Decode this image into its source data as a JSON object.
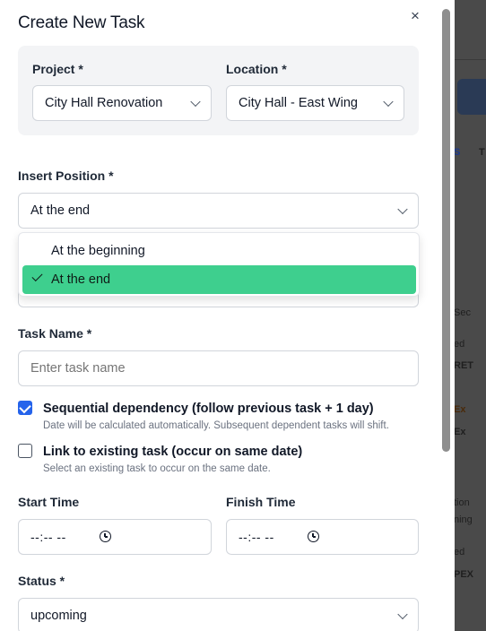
{
  "modal": {
    "title": "Create New Task",
    "close_icon": "×"
  },
  "project": {
    "label": "Project *",
    "value": "City Hall Renovation"
  },
  "location": {
    "label": "Location *",
    "value": "City Hall - East Wing"
  },
  "insert_position": {
    "label": "Insert Position *",
    "value": "At the end",
    "options": [
      {
        "label": "At the beginning",
        "selected": false
      },
      {
        "label": "At the end",
        "selected": true
      }
    ]
  },
  "task_name": {
    "label": "Task Name *",
    "placeholder": "Enter task name",
    "value": ""
  },
  "sequential": {
    "checked": true,
    "label": "Sequential dependency (follow previous task + 1 day)",
    "help": "Date will be calculated automatically. Subsequent dependent tasks will shift."
  },
  "link_existing": {
    "checked": false,
    "label": "Link to existing task (occur on same date)",
    "help": "Select an existing task to occur on the same date."
  },
  "start_time": {
    "label": "Start Time",
    "value": "--:-- --"
  },
  "finish_time": {
    "label": "Finish Time",
    "value": "--:-- --"
  },
  "status": {
    "label": "Status *",
    "value": "upcoming"
  },
  "background": {
    "snippets": [
      "S",
      "T",
      "Sec",
      "ed",
      "RET",
      "Ex",
      "Ex",
      "tion",
      "ning",
      "ed",
      "PEX"
    ]
  },
  "colors": {
    "accent_blue": "#2563eb",
    "selected_option": "#3ecf8e"
  }
}
